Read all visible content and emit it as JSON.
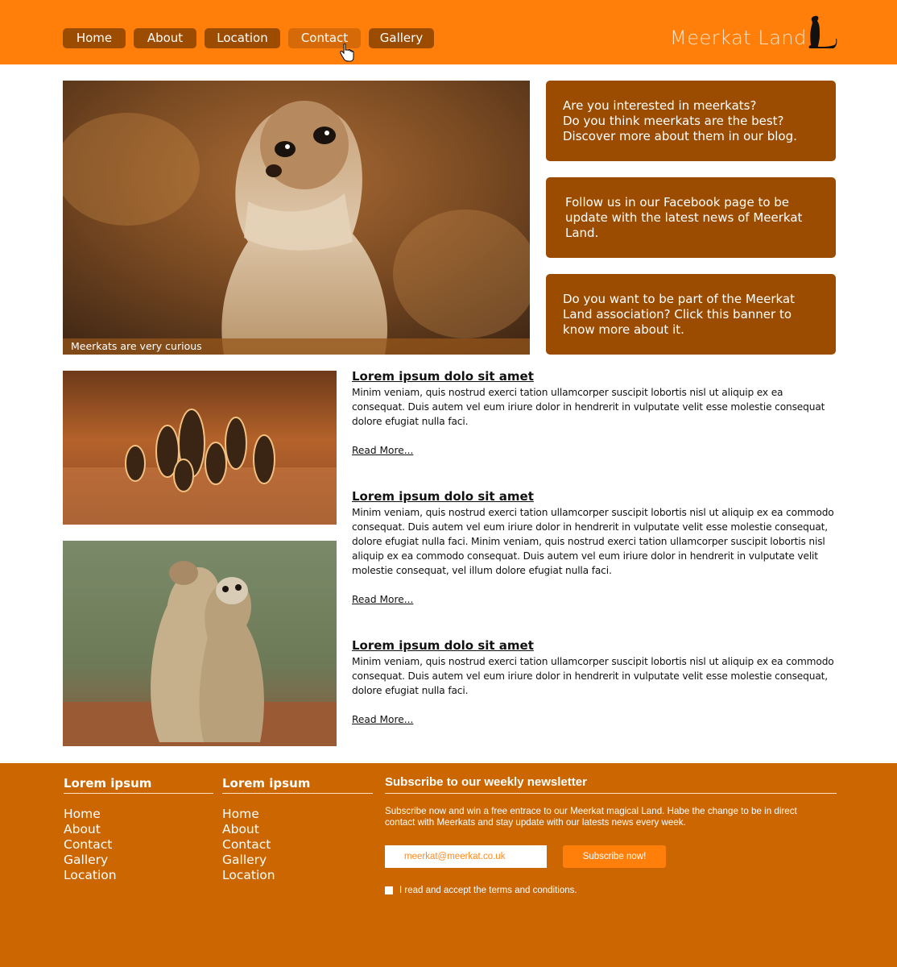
{
  "nav": {
    "items": [
      {
        "label": "Home"
      },
      {
        "label": "About"
      },
      {
        "label": "Location"
      },
      {
        "label": "Contact"
      },
      {
        "label": "Gallery"
      }
    ]
  },
  "logo": {
    "text": "Meerkat Land"
  },
  "hero": {
    "caption": "Meerkats are very curious"
  },
  "sidebar": {
    "boxes": [
      {
        "lines": [
          "Are you interested in meerkats?",
          "Do you think meerkats are the best?",
          "Discover more about them in our blog."
        ]
      },
      {
        "lines": [
          "Follow us in our Facebook page to be",
          "update with the latest news of Meerkat",
          "Land."
        ]
      },
      {
        "lines": [
          "Do you want to be part of the Meerkat",
          "Land association? Click this banner to",
          "know more about it."
        ]
      }
    ]
  },
  "articles": [
    {
      "title": "Lorem ipsum dolo sit amet",
      "body": "Minim veniam, quis nostrud exerci tation ullamcorper suscipit lobortis nisl ut aliquip ex ea consequat. Duis autem vel eum iriure dolor in hendrerit in vulputate velit esse molestie consequat dolore efugiat nulla faci.",
      "link": "Read More..."
    },
    {
      "title": "Lorem ipsum dolo sit amet",
      "body": "Minim veniam, quis nostrud exerci tation ullamcorper suscipit lobortis nisl ut aliquip ex ea commodo consequat. Duis autem vel eum iriure dolor in hendrerit in vulputate velit esse molestie consequat, dolore efugiat nulla faci. Minim veniam, quis nostrud exerci tation ullamcorper suscipit lobortis nisl aliquip ex ea commodo consequat. Duis autem vel eum iriure dolor in hendrerit in vulputate velit molestie consequat, vel illum dolore efugiat nulla faci.",
      "link": "Read More..."
    },
    {
      "title": "Lorem ipsum dolo sit amet",
      "body": "Minim veniam, quis nostrud exerci tation ullamcorper suscipit lobortis nisl ut aliquip ex ea commodo consequat. Duis autem vel eum iriure dolor in hendrerit in vulputate velit esse molestie consequat, dolore efugiat nulla faci.",
      "link": "Read More..."
    }
  ],
  "footer": {
    "columns": [
      {
        "title": "Lorem ipsum",
        "links": [
          "Home",
          "About",
          "Contact",
          "Gallery",
          "Location"
        ]
      },
      {
        "title": "Lorem ipsum",
        "links": [
          "Home",
          "About",
          "Contact",
          "Gallery",
          "Location"
        ]
      }
    ],
    "newsletter": {
      "title": "Subscribe to our weekly newsletter",
      "text": "Subscribe now and win a free entrace to our Meerkat magical Land. Habe the change to be in direct contact with Meerkats and stay update with our latests news every week.",
      "email_placeholder": "meerkat@meerkat.co.uk",
      "button": "Subscribe now!",
      "terms": "I read and accept the terms and conditions."
    }
  },
  "colors": {
    "header": "#ff7f0a",
    "accent_dark": "#9c4c00",
    "footer": "#cc6600"
  }
}
